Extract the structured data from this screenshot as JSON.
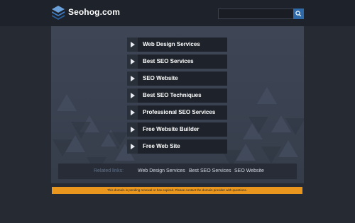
{
  "header": {
    "site_name": "Seohog.com",
    "logo_icon": "stacked-layers-icon",
    "search": {
      "value": "",
      "placeholder": "",
      "button_icon": "search-icon"
    }
  },
  "menu": {
    "items": [
      {
        "label": "Web Design Services",
        "icon": "play-arrow-icon"
      },
      {
        "label": "Best SEO Services",
        "icon": "play-arrow-icon"
      },
      {
        "label": "SEO Website",
        "icon": "play-arrow-icon"
      },
      {
        "label": "Best SEO Techniques",
        "icon": "play-arrow-icon"
      },
      {
        "label": "Professional SEO Services",
        "icon": "play-arrow-icon"
      },
      {
        "label": "Free Website Builder",
        "icon": "play-arrow-icon"
      },
      {
        "label": "Free Web Site",
        "icon": "play-arrow-icon"
      }
    ]
  },
  "related": {
    "label": "Related links:",
    "links": [
      "Web Design Services",
      "Best SEO Services",
      "SEO Website"
    ]
  },
  "notice": {
    "text": "This domain is pending renewal or has expired. Please contact the domain provider with questions."
  },
  "colors": {
    "background": "#252a33",
    "topbar": "#1e222a",
    "panel": "#3e4656",
    "menu_item": "#1e232b",
    "accent_blue": "#2f6aa8",
    "notice": "#e8961e",
    "related_label": "#5f7391"
  }
}
